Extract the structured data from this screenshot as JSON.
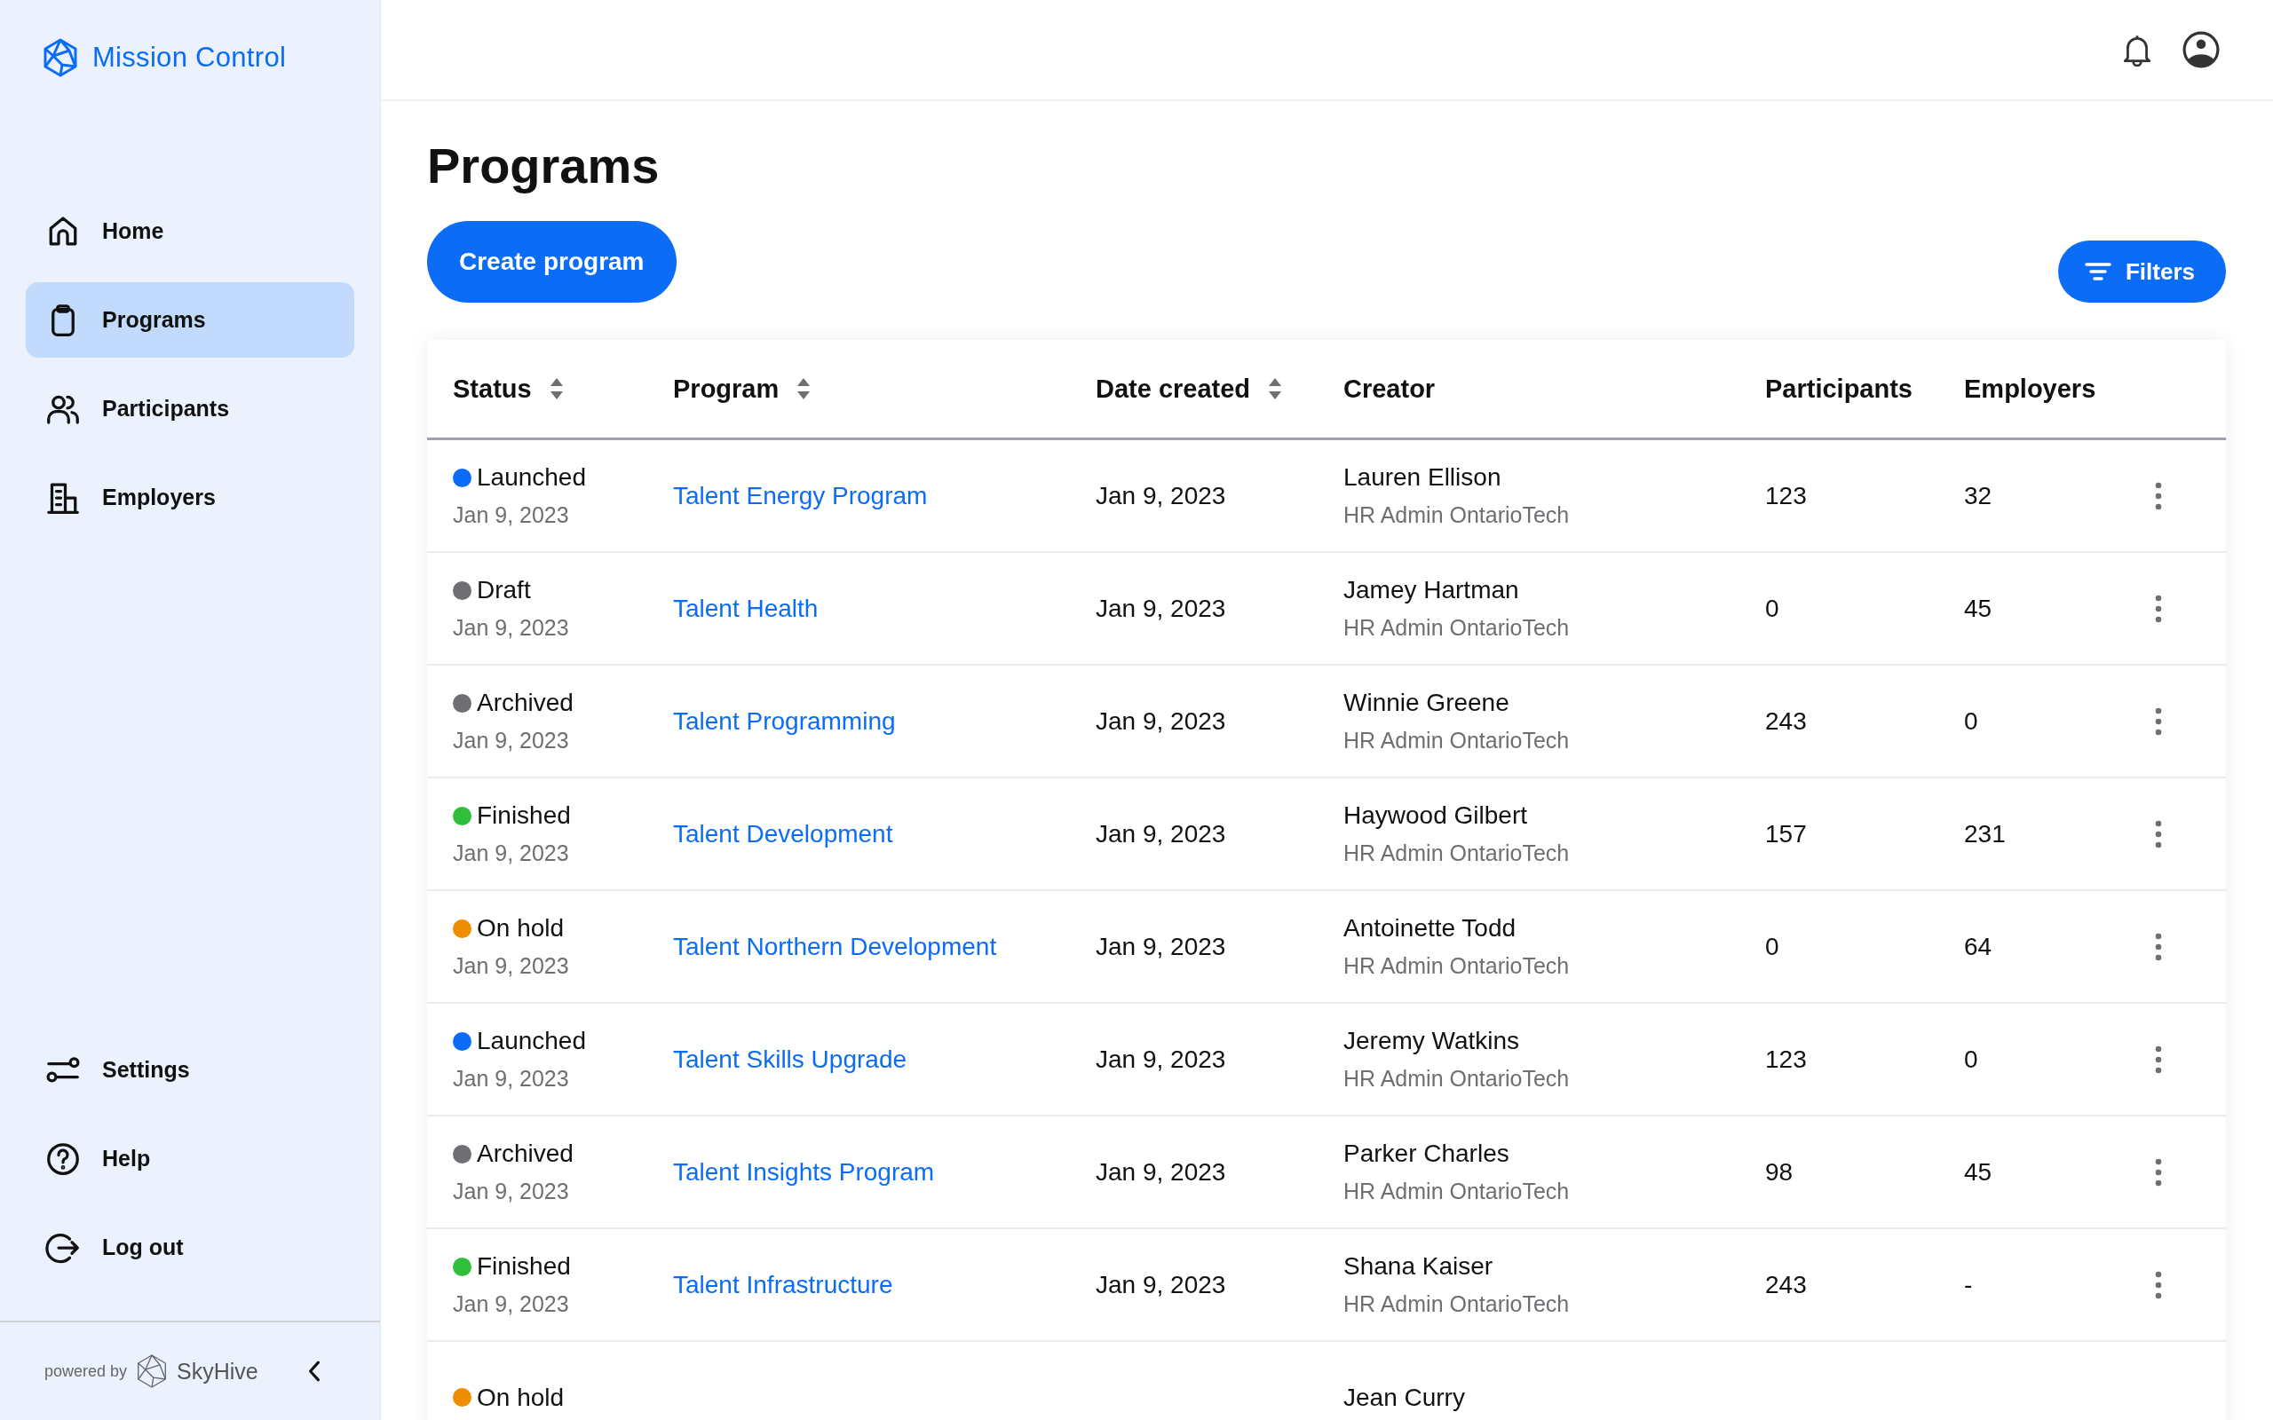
{
  "app": {
    "name": "Mission Control"
  },
  "sidebar": {
    "items": [
      {
        "label": "Home",
        "selected": false
      },
      {
        "label": "Programs",
        "selected": true
      },
      {
        "label": "Participants",
        "selected": false
      },
      {
        "label": "Employers",
        "selected": false
      }
    ],
    "bottom_items": [
      {
        "label": "Settings"
      },
      {
        "label": "Help"
      },
      {
        "label": "Log out"
      }
    ],
    "footer": {
      "powered_by": "powered by",
      "brand": "SkyHive"
    }
  },
  "page": {
    "title": "Programs",
    "create_button": "Create program",
    "filters_button": "Filters"
  },
  "table": {
    "columns": [
      {
        "label": "Status",
        "sortable": true
      },
      {
        "label": "Program",
        "sortable": true
      },
      {
        "label": "Date created",
        "sortable": true
      },
      {
        "label": "Creator",
        "sortable": false
      },
      {
        "label": "Participants",
        "sortable": false
      },
      {
        "label": "Employers",
        "sortable": false
      }
    ],
    "rows": [
      {
        "status": "Launched",
        "color": "#0b6cf5",
        "status_date": "Jan 9, 2023",
        "program": "Talent Energy Program",
        "date": "Jan 9, 2023",
        "creator": "Lauren Ellison",
        "creator_role": "HR Admin OntarioTech",
        "participants": "123",
        "employers": "32"
      },
      {
        "status": "Draft",
        "color": "#6e6e73",
        "status_date": "Jan 9, 2023",
        "program": "Talent Health",
        "date": "Jan 9, 2023",
        "creator": "Jamey Hartman",
        "creator_role": "HR Admin OntarioTech",
        "participants": "0",
        "employers": "45"
      },
      {
        "status": "Archived",
        "color": "#6e6e73",
        "status_date": "Jan 9, 2023",
        "program": "Talent Programming",
        "date": "Jan 9, 2023",
        "creator": "Winnie Greene",
        "creator_role": "HR Admin OntarioTech",
        "participants": "243",
        "employers": "0"
      },
      {
        "status": "Finished",
        "color": "#2fbf3a",
        "status_date": "Jan 9, 2023",
        "program": "Talent Development",
        "date": "Jan 9, 2023",
        "creator": "Haywood Gilbert",
        "creator_role": "HR Admin OntarioTech",
        "participants": "157",
        "employers": "231"
      },
      {
        "status": "On hold",
        "color": "#f08c00",
        "status_date": "Jan 9, 2023",
        "program": "Talent Northern Development",
        "date": "Jan 9, 2023",
        "creator": "Antoinette Todd",
        "creator_role": "HR Admin OntarioTech",
        "participants": "0",
        "employers": "64"
      },
      {
        "status": "Launched",
        "color": "#0b6cf5",
        "status_date": "Jan 9, 2023",
        "program": "Talent Skills Upgrade",
        "date": "Jan 9, 2023",
        "creator": "Jeremy Watkins",
        "creator_role": "HR Admin OntarioTech",
        "participants": "123",
        "employers": "0"
      },
      {
        "status": "Archived",
        "color": "#6e6e73",
        "status_date": "Jan 9, 2023",
        "program": "Talent Insights Program",
        "date": "Jan 9, 2023",
        "creator": "Parker Charles",
        "creator_role": "HR Admin OntarioTech",
        "participants": "98",
        "employers": "45"
      },
      {
        "status": "Finished",
        "color": "#2fbf3a",
        "status_date": "Jan 9, 2023",
        "program": "Talent Infrastructure",
        "date": "Jan 9, 2023",
        "creator": "Shana Kaiser",
        "creator_role": "HR Admin OntarioTech",
        "participants": "243",
        "employers": "-"
      },
      {
        "status": "On hold",
        "color": "#f08c00",
        "creator": "Jean Curry"
      }
    ]
  }
}
